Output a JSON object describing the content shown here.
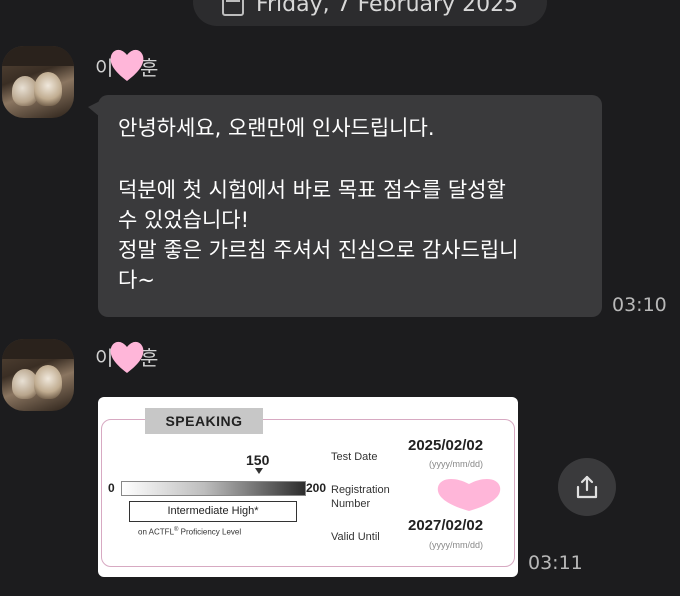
{
  "date_divider": {
    "label": "Friday, 7 February 2025",
    "icon": "calendar-icon"
  },
  "messages": [
    {
      "sender": {
        "name_prefix": "이",
        "name_suffix": "훈"
      },
      "lines": [
        "안녕하세요, 오랜만에 인사드립니다.",
        "",
        "덕분에 첫 시험에서 바로 목표 점수를 달성할",
        "수 있었습니다!",
        "정말 좋은 가르침 주셔서 진심으로 감사드립니",
        "다~"
      ],
      "time": "03:10"
    },
    {
      "sender": {
        "name_prefix": "이",
        "name_suffix": "훈"
      },
      "attachment": {
        "section": "SPEAKING",
        "score": "150",
        "scale_min": "0",
        "scale_max": "200",
        "level": "Intermediate High*",
        "scale_note": "on ACTFL",
        "scale_note_mark": "®",
        "scale_note_suffix": "Proficiency Level",
        "test_date_label": "Test Date",
        "test_date": "2025/02/02",
        "date_format": "(yyyy/mm/dd)",
        "registration_label_1": "Registration",
        "registration_label_2": "Number",
        "valid_until_label": "Valid Until",
        "valid_until": "2027/02/02"
      },
      "time": "03:11"
    }
  ],
  "share_icon": "share-icon",
  "colors": {
    "background": "#1c1c1e",
    "bubble": "#3a3a3c",
    "heart": "#ffb6d9"
  }
}
